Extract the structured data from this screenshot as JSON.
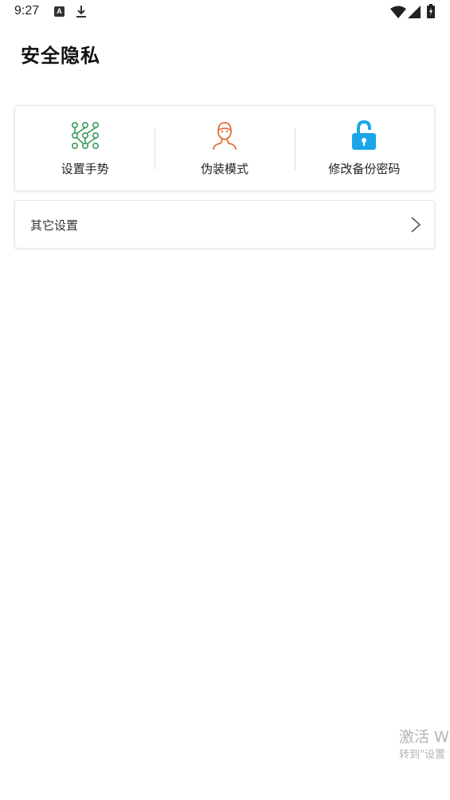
{
  "status_bar": {
    "time": "9:27",
    "notification_icon_letter": "A",
    "icons": [
      "a-notification-icon",
      "download-icon",
      "wifi-icon",
      "signal-icon",
      "battery-charging-icon"
    ]
  },
  "page": {
    "title": "安全隐私"
  },
  "shortcuts": [
    {
      "label": "设置手势",
      "icon": "gesture-pattern-icon",
      "color": "#3a9a5b"
    },
    {
      "label": "伪装模式",
      "icon": "disguise-person-icon",
      "color": "#e0703a"
    },
    {
      "label": "修改备份密码",
      "icon": "unlock-icon",
      "color": "#1aa6e8"
    }
  ],
  "other_settings": {
    "label": "其它设置",
    "icon": "chevron-right-icon"
  },
  "watermark": {
    "line1": "激活 W",
    "line2": "转到\"设置"
  }
}
